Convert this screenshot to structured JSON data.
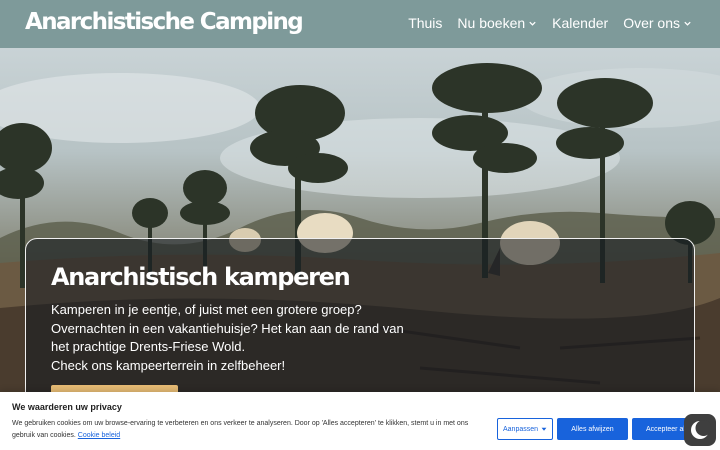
{
  "header": {
    "logo": "Anarchistische Camping",
    "nav": [
      {
        "label": "Thuis",
        "has_dropdown": false
      },
      {
        "label": "Nu boeken",
        "has_dropdown": true
      },
      {
        "label": "Kalender",
        "has_dropdown": false
      },
      {
        "label": "Over ons",
        "has_dropdown": true
      }
    ]
  },
  "hero": {
    "title": "Anarchistisch kamperen",
    "lines": [
      "Kamperen in je eentje, of juist met een grotere groep?",
      "Overnachten in een vakantiehuisje? Het kan aan de rand van",
      "het prachtige Drents-Friese Wold.",
      "Check ons kampeerterrein in zelfbeheer!"
    ],
    "image_description_icon": "landscape-with-trees-and-sheep"
  },
  "cookie_banner": {
    "title": "We waarderen uw privacy",
    "text": "We gebruiken cookies om uw browse-ervaring te verbeteren en ons verkeer te analyseren. Door op 'Alles accepteren' te klikken, stemt u in met ons gebruik van cookies.",
    "link": "Cookie beleid",
    "customize_label": "Aanpassen",
    "reject_label": "Alles afwijzen",
    "accept_label": "Accepteer al"
  },
  "colors": {
    "header_bg": "#7e9a9a",
    "cookie_blue": "#1863dc",
    "cta_gold": "#e6bb74"
  }
}
